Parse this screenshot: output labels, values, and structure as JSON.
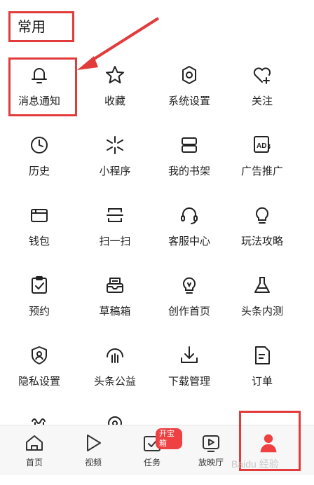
{
  "section": {
    "title": "常用"
  },
  "grid_items": [
    {
      "label": "消息通知",
      "icon": "bell-icon"
    },
    {
      "label": "收藏",
      "icon": "star-icon"
    },
    {
      "label": "系统设置",
      "icon": "gear-icon"
    },
    {
      "label": "关注",
      "icon": "heart-plus-icon"
    },
    {
      "label": "历史",
      "icon": "clock-icon"
    },
    {
      "label": "小程序",
      "icon": "asterisk-icon"
    },
    {
      "label": "我的书架",
      "icon": "bookshelf-icon"
    },
    {
      "label": "广告推广",
      "icon": "ad-icon"
    },
    {
      "label": "钱包",
      "icon": "wallet-icon"
    },
    {
      "label": "扫一扫",
      "icon": "scan-icon"
    },
    {
      "label": "客服中心",
      "icon": "headset-icon"
    },
    {
      "label": "玩法攻略",
      "icon": "lightbulb-icon"
    },
    {
      "label": "预约",
      "icon": "clipboard-check-icon"
    },
    {
      "label": "草稿箱",
      "icon": "inbox-icon"
    },
    {
      "label": "创作首页",
      "icon": "bulb-pen-icon"
    },
    {
      "label": "头条内测",
      "icon": "flask-icon"
    },
    {
      "label": "隐私设置",
      "icon": "shield-user-icon"
    },
    {
      "label": "头条公益",
      "icon": "charity-hand-icon"
    },
    {
      "label": "下载管理",
      "icon": "download-icon"
    },
    {
      "label": "订单",
      "icon": "document-icon"
    },
    {
      "label": "",
      "icon": "partial-icon"
    },
    {
      "label": "",
      "icon": "location-pin-icon"
    }
  ],
  "tabbar": {
    "tabs": [
      {
        "label": "首页",
        "icon": "home-icon"
      },
      {
        "label": "视频",
        "icon": "play-icon"
      },
      {
        "label": "任务",
        "icon": "task-check-icon"
      },
      {
        "label": "放映厅",
        "icon": "cinema-icon"
      },
      {
        "label": "",
        "icon": "profile-person-icon"
      }
    ],
    "badge": "开宝箱"
  },
  "watermark": "Baidu 经验",
  "colors": {
    "annotation": "#e23b3b",
    "badge": "#f04142",
    "profile_active": "#f04142"
  }
}
